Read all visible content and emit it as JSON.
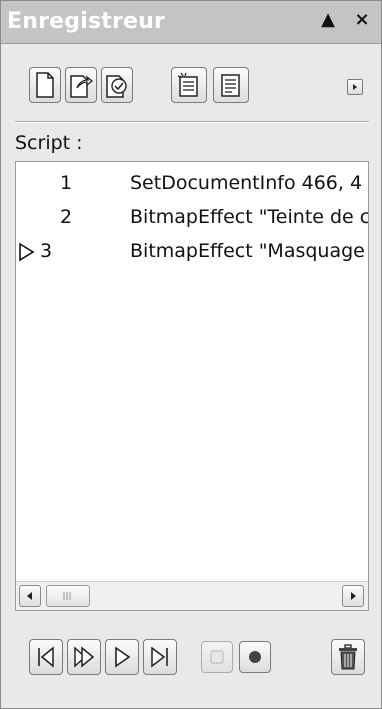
{
  "window": {
    "title": "Enregistreur",
    "collapse_glyph": "▲",
    "close_glyph": "×"
  },
  "toolbar": {
    "icons": [
      "new-document-icon",
      "open-document-icon",
      "save-document-icon",
      "insert-script-icon",
      "script-properties-icon",
      "flyout-menu-icon"
    ]
  },
  "script": {
    "label": "Script :",
    "rows": [
      {
        "num": "1",
        "command": "SetDocumentInfo 466, 4",
        "current": false
      },
      {
        "num": "2",
        "command": "BitmapEffect \"Teinte de c",
        "current": false
      },
      {
        "num": "3",
        "command": "BitmapEffect \"Masquage",
        "current": true
      }
    ]
  },
  "playback": {
    "icons": [
      "rewind-to-start-icon",
      "step-icon",
      "play-icon",
      "skip-to-end-icon",
      "stop-icon",
      "record-icon",
      "delete-icon"
    ],
    "disabled": [
      "stop-icon"
    ]
  }
}
